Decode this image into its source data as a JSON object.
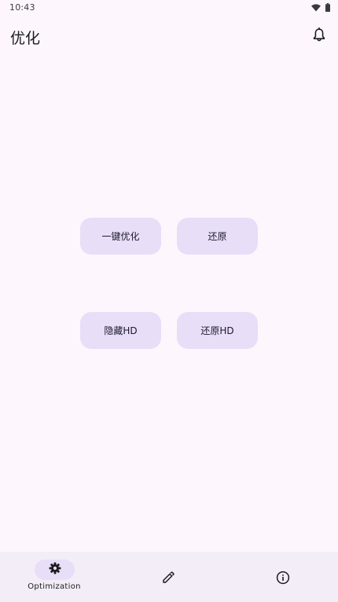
{
  "status_bar": {
    "time": "10:43",
    "icons": [
      "wifi-icon",
      "battery-icon"
    ]
  },
  "app_bar": {
    "title": "优化",
    "action_icon": "bell-icon"
  },
  "actions": {
    "optimize_label": "一键优化",
    "restore_label": "还原",
    "hide_hd_label": "隐藏HD",
    "restore_hd_label": "还原HD"
  },
  "bottom_nav": {
    "items": [
      {
        "label": "Optimization",
        "icon": "gear-icon",
        "selected": true
      },
      {
        "label": "",
        "icon": "pencil-icon",
        "selected": false
      },
      {
        "label": "",
        "icon": "info-icon",
        "selected": false
      }
    ]
  },
  "colors": {
    "background": "#fdf7fd",
    "button_fill": "#e8def8",
    "nav_background": "#f2edf6",
    "active_indicator": "#e8def8"
  }
}
